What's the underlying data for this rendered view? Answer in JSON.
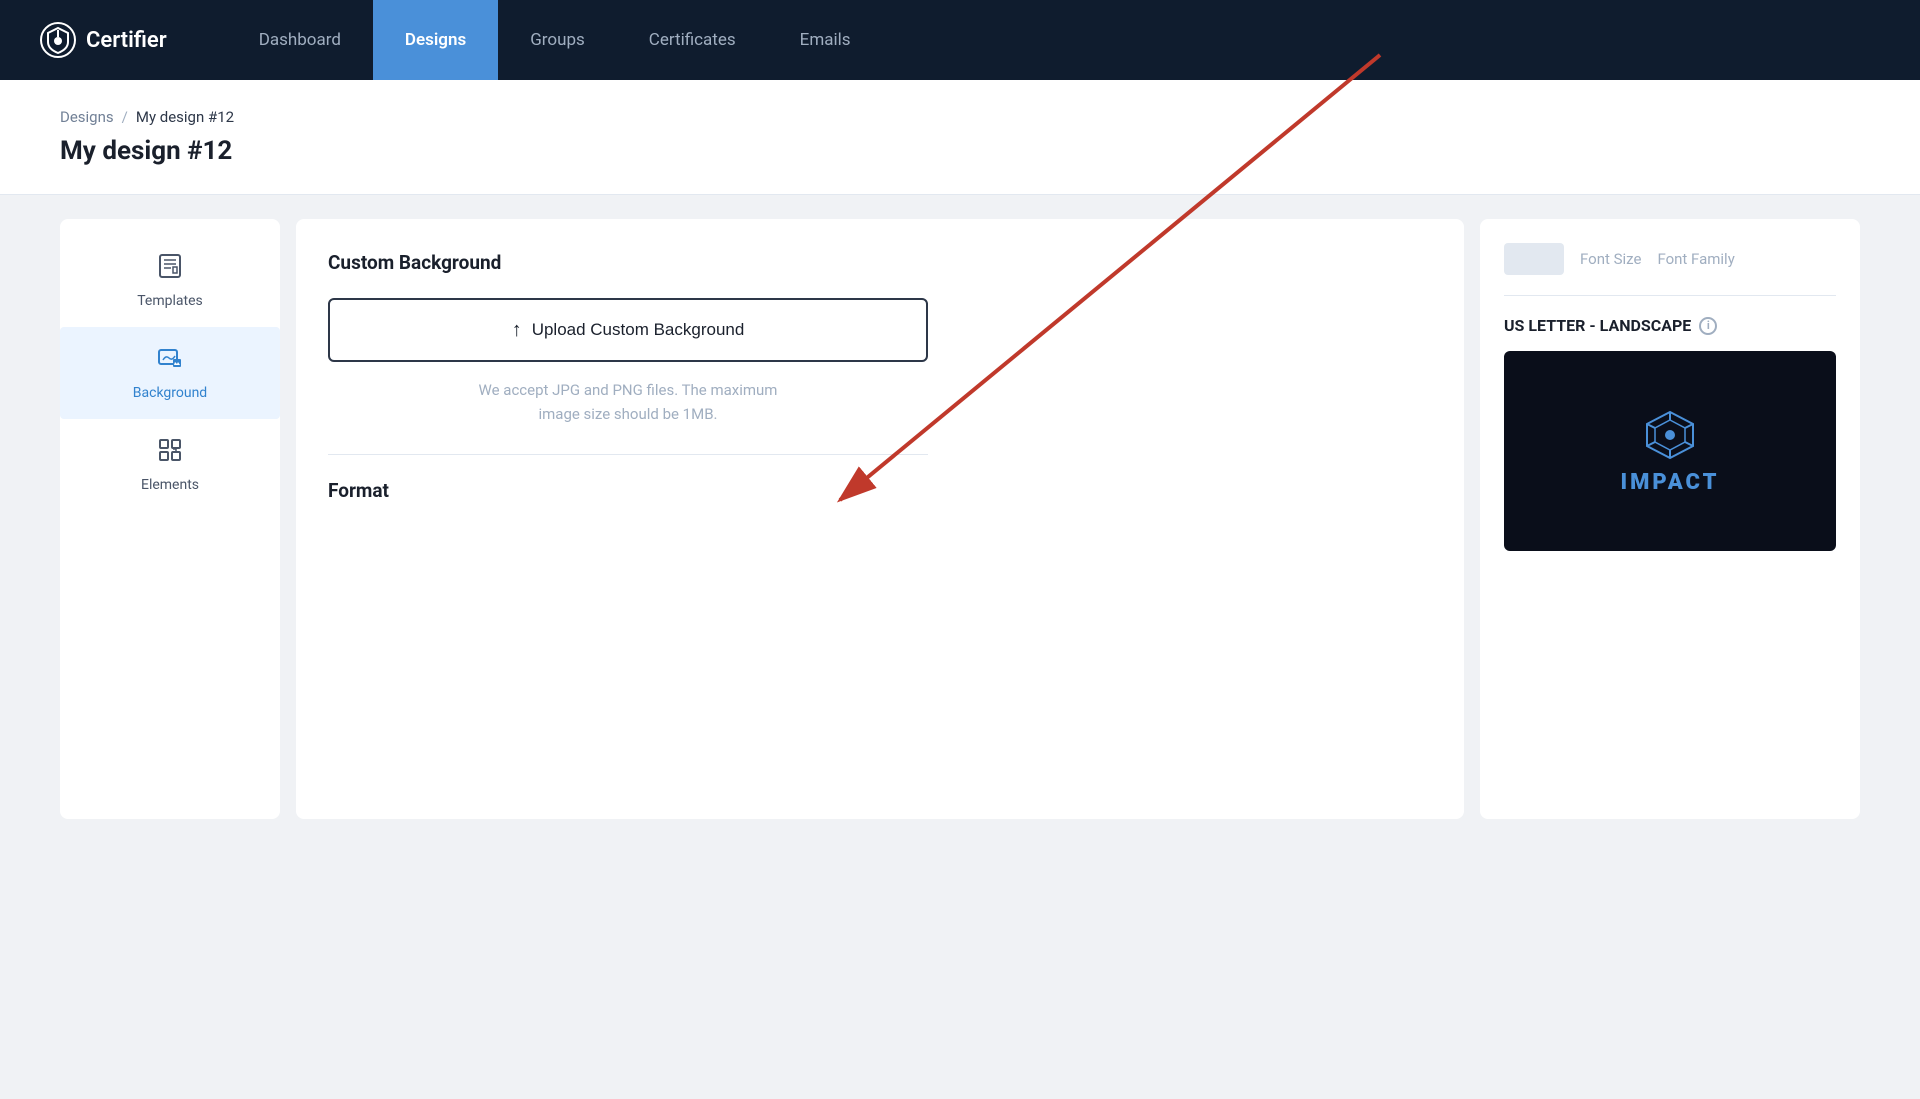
{
  "nav": {
    "brand": "Certifier",
    "items": [
      {
        "label": "Dashboard",
        "active": false
      },
      {
        "label": "Designs",
        "active": true
      },
      {
        "label": "Groups",
        "active": false
      },
      {
        "label": "Certificates",
        "active": false
      },
      {
        "label": "Emails",
        "active": false
      }
    ]
  },
  "breadcrumb": {
    "parent": "Designs",
    "separator": "/",
    "current": "My design #12"
  },
  "page": {
    "title": "My design #12"
  },
  "sidebar": {
    "items": [
      {
        "label": "Templates",
        "active": false,
        "icon": "📄"
      },
      {
        "label": "Background",
        "active": true,
        "icon": "🖌"
      },
      {
        "label": "Elements",
        "active": false,
        "icon": "⊞"
      }
    ]
  },
  "content": {
    "section_title": "Custom Background",
    "upload_button_label": "Upload Custom Background",
    "upload_hint_line1": "We accept JPG and PNG files. The maximum",
    "upload_hint_line2": "image size should be 1MB.",
    "format_title": "Format"
  },
  "right_panel": {
    "font_size_label": "Font Size",
    "font_family_label": "Font Family",
    "template_section_title": "US LETTER - LANDSCAPE",
    "template_preview_text": "IMPACT"
  }
}
